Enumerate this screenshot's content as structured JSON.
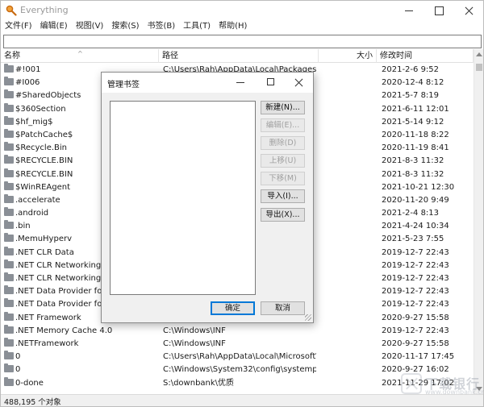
{
  "window": {
    "title": "Everything"
  },
  "menu": [
    "文件(F)",
    "编辑(E)",
    "视图(V)",
    "搜索(S)",
    "书签(B)",
    "工具(T)",
    "帮助(H)"
  ],
  "search": {
    "value": ""
  },
  "columns": {
    "name": "名称",
    "path": "路径",
    "size": "大小",
    "date": "修改时间"
  },
  "rows": [
    {
      "name": "#!001",
      "path": "C:\\Users\\Rah\\AppData\\Local\\Packages\\...",
      "date": "2021-2-6 9:52"
    },
    {
      "name": "#I006",
      "path": "",
      "date": "2020-12-4 8:12"
    },
    {
      "name": "#SharedObjects",
      "path": "",
      "date": "2021-5-7 8:19"
    },
    {
      "name": "$360Section",
      "path": "",
      "date": "2021-6-11 12:01"
    },
    {
      "name": "$hf_mig$",
      "path": "",
      "date": "2021-5-14 9:12"
    },
    {
      "name": "$PatchCache$",
      "path": "",
      "date": "2020-11-18 8:22"
    },
    {
      "name": "$Recycle.Bin",
      "path": "",
      "date": "2020-11-19 8:41"
    },
    {
      "name": "$RECYCLE.BIN",
      "path": "",
      "date": "2021-8-3 11:32"
    },
    {
      "name": "$RECYCLE.BIN",
      "path": "",
      "date": "2021-8-3 11:32"
    },
    {
      "name": "$WinREAgent",
      "path": "",
      "date": "2021-10-21 12:30"
    },
    {
      "name": ".accelerate",
      "path": "",
      "date": "2020-11-20 9:49"
    },
    {
      "name": ".android",
      "path": "",
      "date": "2021-2-4 8:13"
    },
    {
      "name": ".bin",
      "path": "",
      "date": "2021-4-24 10:34"
    },
    {
      "name": ".MemuHyperv",
      "path": "",
      "date": "2021-5-23 7:55"
    },
    {
      "name": ".NET CLR Data",
      "path": "",
      "date": "2019-12-7 22:43"
    },
    {
      "name": ".NET CLR Networking",
      "path": "",
      "date": "2019-12-7 22:43"
    },
    {
      "name": ".NET CLR Networking 4.0",
      "path": "",
      "date": "2019-12-7 22:43"
    },
    {
      "name": ".NET Data Provider for O",
      "path": "",
      "date": "2019-12-7 22:43"
    },
    {
      "name": ".NET Data Provider for S",
      "path": "",
      "date": "2019-12-7 22:43"
    },
    {
      "name": ".NET Framework",
      "path": "",
      "date": "2020-9-27 15:58"
    },
    {
      "name": ".NET Memory Cache 4.0",
      "path": "C:\\Windows\\INF",
      "date": "2019-12-7 22:43"
    },
    {
      "name": ".NETFramework",
      "path": "C:\\Windows\\INF",
      "date": "2020-9-27 15:58"
    },
    {
      "name": "0",
      "path": "C:\\Users\\Rah\\AppData\\Local\\Microsoft\\...",
      "date": "2020-11-17 17:45"
    },
    {
      "name": "0",
      "path": "C:\\Windows\\System32\\config\\systempro...",
      "date": "2020-9-27 16:02"
    },
    {
      "name": "0-done",
      "path": "S:\\downbank\\优质",
      "date": "2021-11-29 17:02"
    }
  ],
  "status": {
    "text": "488,195 个对象"
  },
  "dialog": {
    "title": "管理书签",
    "buttons": {
      "new": "新建(N)...",
      "edit": "编辑(E)...",
      "delete": "删除(D)",
      "up": "上移(U)",
      "down": "下移(M)",
      "import": "导入(I)...",
      "export": "导出(X)..."
    },
    "ok": "确定",
    "cancel": "取消"
  },
  "watermark": {
    "text": "下载银行",
    "url": "www.downbank.cn"
  },
  "colors": {
    "folder": "#8a8f96",
    "focus": "#0078d7",
    "disabled": "#a0a0a0"
  }
}
